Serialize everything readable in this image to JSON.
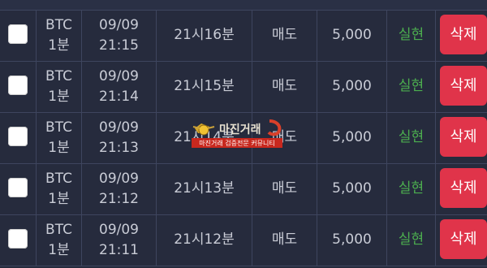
{
  "header": {
    "cols": [
      "",
      "",
      "",
      "",
      "",
      "",
      "",
      ""
    ]
  },
  "rows": [
    {
      "coin": "BTC",
      "interval": "1분",
      "date": "09/09",
      "time": "21:15",
      "round": "21시16분",
      "side": "매도",
      "amount": "5,000",
      "status": "실현",
      "delete_label": "삭제"
    },
    {
      "coin": "BTC",
      "interval": "1분",
      "date": "09/09",
      "time": "21:14",
      "round": "21시15분",
      "side": "매도",
      "amount": "5,000",
      "status": "실현",
      "delete_label": "삭제"
    },
    {
      "coin": "BTC",
      "interval": "1분",
      "date": "09/09",
      "time": "21:13",
      "round": "21시14분",
      "side": "매도",
      "amount": "5,000",
      "status": "실현",
      "delete_label": "삭제"
    },
    {
      "coin": "BTC",
      "interval": "1분",
      "date": "09/09",
      "time": "21:12",
      "round": "21시13분",
      "side": "매도",
      "amount": "5,000",
      "status": "실현",
      "delete_label": "삭제"
    },
    {
      "coin": "BTC",
      "interval": "1분",
      "date": "09/09",
      "time": "21:11",
      "round": "21시12분",
      "side": "매도",
      "amount": "5,000",
      "status": "실현",
      "delete_label": "삭제"
    }
  ],
  "watermark": {
    "title": "마진거래",
    "subtitle": "마진거래 검증전문 커뮤니티"
  },
  "colors": {
    "background": "#262b3d",
    "grid": "#3e455e",
    "text": "#c9ccd6",
    "status": "#4cae4f",
    "delete": "#e0344a"
  }
}
